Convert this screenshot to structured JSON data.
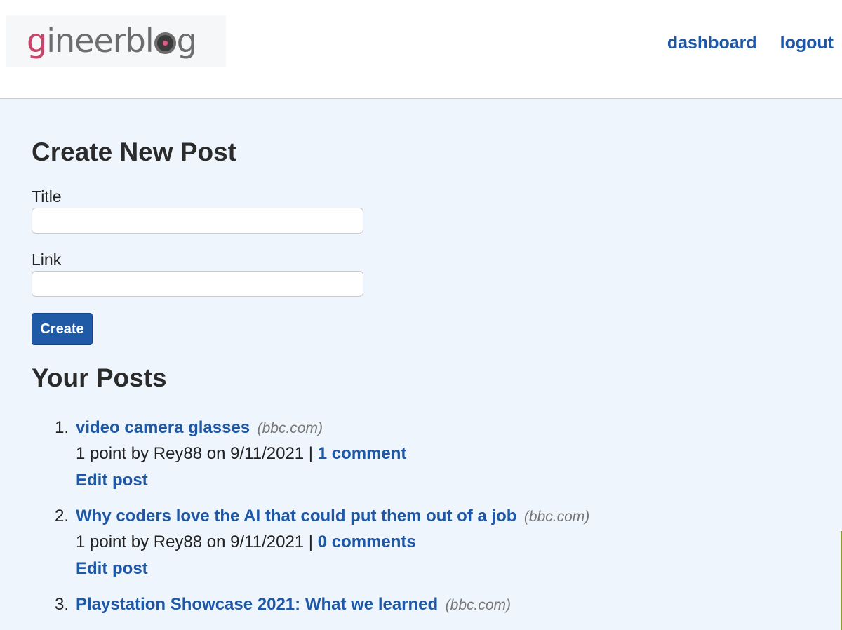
{
  "header": {
    "logo_text_first": "g",
    "logo_text_rest": "ineerbl",
    "logo_text_end": "g",
    "nav": {
      "dashboard": "dashboard",
      "logout": "logout"
    }
  },
  "create_form": {
    "heading": "Create New Post",
    "title_label": "Title",
    "title_value": "",
    "link_label": "Link",
    "link_value": "",
    "submit_label": "Create"
  },
  "posts_section": {
    "heading": "Your Posts",
    "posts": [
      {
        "number": "1.",
        "title": "video camera glasses",
        "domain": "(bbc.com)",
        "meta_prefix": "1 point by Rey88 on 9/11/2021 |",
        "comments": "1 comment",
        "edit": "Edit post"
      },
      {
        "number": "2.",
        "title": "Why coders love the AI that could put them out of a job",
        "domain": "(bbc.com)",
        "meta_prefix": "1 point by Rey88 on 9/11/2021 |",
        "comments": "0 comments",
        "edit": "Edit post"
      },
      {
        "number": "3.",
        "title": "Playstation Showcase 2021: What we learned",
        "domain": "(bbc.com)"
      }
    ]
  },
  "colors": {
    "accent": "#1d57a6",
    "button": "#1f5aa7",
    "page_background": "#eef5fc",
    "logo_pink": "#c9446b"
  }
}
